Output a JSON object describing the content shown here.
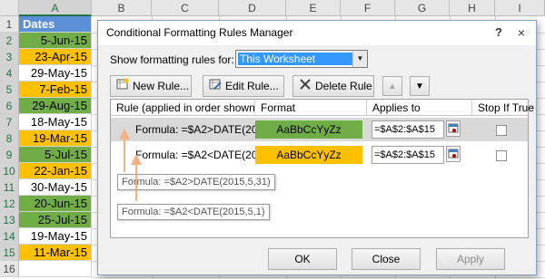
{
  "sheet": {
    "columns": [
      "A",
      "B",
      "C",
      "D",
      "E",
      "F",
      "G",
      "H",
      "I"
    ],
    "rows": [
      {
        "num": "1",
        "value": "Dates",
        "style": "header"
      },
      {
        "num": "2",
        "value": "5-Jun-15",
        "style": "green"
      },
      {
        "num": "3",
        "value": "23-Apr-15",
        "style": "orange"
      },
      {
        "num": "4",
        "value": "29-May-15",
        "style": "white"
      },
      {
        "num": "5",
        "value": "7-Feb-15",
        "style": "orange"
      },
      {
        "num": "6",
        "value": "29-Aug-15",
        "style": "green"
      },
      {
        "num": "7",
        "value": "18-May-15",
        "style": "white"
      },
      {
        "num": "8",
        "value": "19-Mar-15",
        "style": "orange"
      },
      {
        "num": "9",
        "value": "5-Jul-15",
        "style": "green"
      },
      {
        "num": "10",
        "value": "22-Jan-15",
        "style": "orange"
      },
      {
        "num": "11",
        "value": "30-May-15",
        "style": "white"
      },
      {
        "num": "12",
        "value": "20-Jun-15",
        "style": "green"
      },
      {
        "num": "13",
        "value": "25-Jul-15",
        "style": "green"
      },
      {
        "num": "14",
        "value": "19-May-15",
        "style": "white"
      },
      {
        "num": "15",
        "value": "11-Mar-15",
        "style": "orange"
      },
      {
        "num": "16",
        "value": "",
        "style": "white"
      }
    ],
    "colors": {
      "header": "#5b8fd6",
      "green": "#70ad47",
      "orange": "#ffc000"
    }
  },
  "dialog": {
    "title": "Conditional Formatting Rules Manager",
    "help_glyph": "?",
    "close_glyph": "×",
    "show_rules_label": "Show formatting rules for:",
    "show_rules_value": "This Worksheet",
    "toolbar": {
      "new_rule": "New Rule...",
      "edit_rule": "Edit Rule...",
      "delete_rule": "Delete Rule",
      "move_up_glyph": "▲",
      "move_down_glyph": "▼"
    },
    "columns": {
      "rule": "Rule (applied in order shown)",
      "format": "Format",
      "applies_to": "Applies to",
      "stop_if_true": "Stop If True"
    },
    "rules": [
      {
        "formula": "Formula: =$A2>DATE(20...",
        "format_preview": "AaBbCcYyZz",
        "format_color": "#70ad47",
        "applies_to": "=$A$2:$A$15",
        "stop_if_true": false
      },
      {
        "formula": "Formula: =$A2<DATE(20...",
        "format_preview": "AaBbCcYyZz",
        "format_color": "#ffc000",
        "applies_to": "=$A$2:$A$15",
        "stop_if_true": false
      }
    ],
    "tooltips": [
      "Formula: =$A2>DATE(2015,5,31)",
      "Formula: =$A2<DATE(2015,5,1)"
    ],
    "buttons": {
      "ok": "OK",
      "close": "Close",
      "apply": "Apply"
    },
    "annotation_color": "#f4b183"
  }
}
